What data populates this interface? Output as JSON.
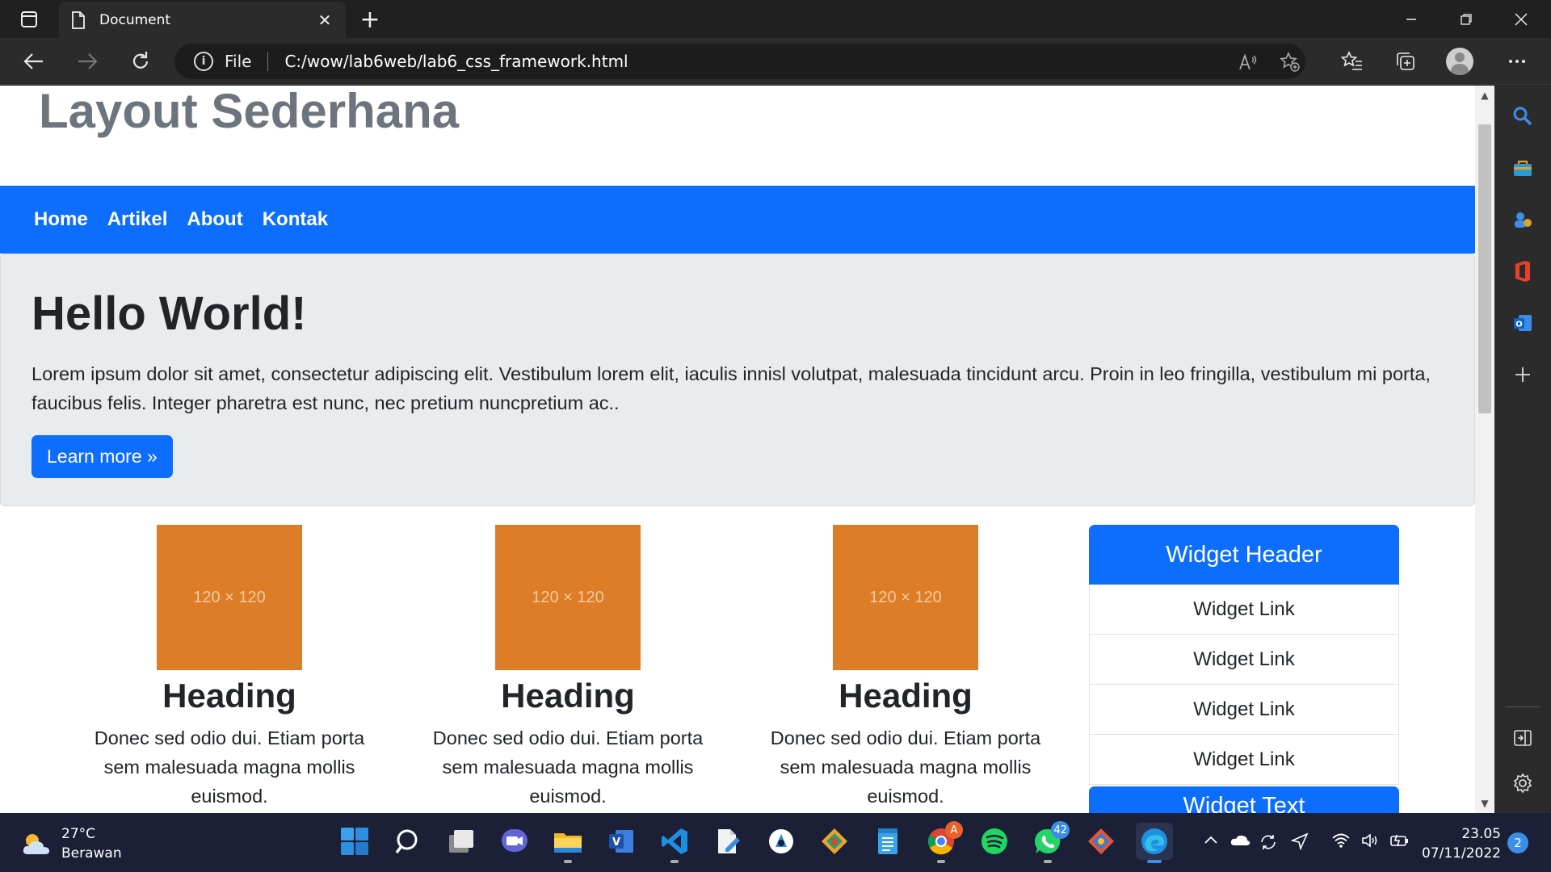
{
  "browser": {
    "tab_title": "Document",
    "tab_close": "✕",
    "new_tab": "+",
    "address_scheme": "File",
    "address_url": "C:/wow/lab6web/lab6_css_framework.html"
  },
  "page": {
    "site_title": "Layout Sederhana",
    "nav": [
      "Home",
      "Artikel",
      "About",
      "Kontak"
    ],
    "jumbotron": {
      "title": "Hello World!",
      "text": "Lorem ipsum dolor sit amet, consectetur adipiscing elit. Vestibulum lorem elit, iaculis innisl volutpat, malesuada tincidunt arcu. Proin in leo fringilla, vestibulum mi porta, faucibus felis. Integer pharetra est nunc, nec pretium nuncpretium ac..",
      "button": "Learn more »"
    },
    "features": [
      {
        "image": "120 × 120",
        "heading": "Heading",
        "text": "Donec sed odio dui. Etiam porta sem malesuada magna mollis euismod."
      },
      {
        "image": "120 × 120",
        "heading": "Heading",
        "text": "Donec sed odio dui. Etiam porta sem malesuada magna mollis euismod."
      },
      {
        "image": "120 × 120",
        "heading": "Heading",
        "text": "Donec sed odio dui. Etiam porta sem malesuada magna mollis euismod."
      }
    ],
    "widget": {
      "header": "Widget Header",
      "links": [
        "Widget Link",
        "Widget Link",
        "Widget Link",
        "Widget Link"
      ],
      "text_header": "Widget Text"
    }
  },
  "taskbar": {
    "weather_temp": "27°C",
    "weather_desc": "Berawan",
    "chrome_badge": "A",
    "whatsapp_badge": "42",
    "time": "23.05",
    "date": "07/11/2022",
    "notifications": "2"
  },
  "colors": {
    "brand_primary": "#0d6efd",
    "jumbotron_bg": "#e9ecef",
    "placeholder_image": "#dd7d27",
    "title_gray": "#6c757d"
  }
}
